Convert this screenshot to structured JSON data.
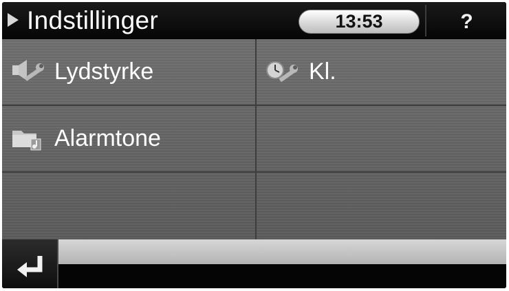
{
  "header": {
    "title": "Indstillinger",
    "clock": "13:53",
    "help_label": "?"
  },
  "menu": {
    "items": [
      {
        "label": "Lydstyrke",
        "icon": "speaker-wrench-icon"
      },
      {
        "label": "Kl.",
        "icon": "clock-wrench-icon"
      },
      {
        "label": "Alarmtone",
        "icon": "folder-music-icon"
      }
    ]
  },
  "footer": {
    "back_icon": "return-arrow-icon"
  },
  "colors": {
    "background": "#5f5f5f",
    "bar": "#050505",
    "text": "#ffffff",
    "clock_bg": "#e2e2e2"
  }
}
